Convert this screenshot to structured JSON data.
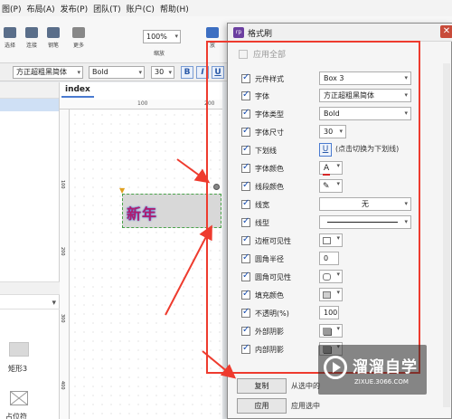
{
  "menu": [
    "图(P)",
    "布局(A)",
    "发布(P)",
    "团队(T)",
    "账户(C)",
    "帮助(H)"
  ],
  "toolbar": {
    "tools": [
      "选择",
      "连接",
      "钢笔",
      "更多"
    ],
    "zoom": "100%",
    "zoom_label": "缩放",
    "partial_label": "放"
  },
  "format_bar": {
    "font": "方正超粗黑简体",
    "weight": "Bold",
    "size": "30",
    "bold": "B",
    "italic": "I",
    "underline": "U"
  },
  "canvas": {
    "tab": "index",
    "ruler_marks": [
      "100",
      "200"
    ],
    "ruler_left_marks": [
      "100",
      "200",
      "300",
      "400"
    ],
    "widget_text": "新年"
  },
  "library": {
    "rect_label": "矩形3",
    "placeholder_label": "占位符"
  },
  "dialog": {
    "icon_text": "rp",
    "title": "格式刷",
    "apply_all": "应用全部",
    "rows": [
      {
        "label": "元件样式",
        "value": "Box 3"
      },
      {
        "label": "字体",
        "value": "方正超粗黑简体"
      },
      {
        "label": "字体类型",
        "value": "Bold"
      },
      {
        "label": "字体尺寸",
        "value": "30"
      },
      {
        "label": "下划线",
        "value": "U",
        "hint": "(点击切换为下划线)"
      },
      {
        "label": "字体颜色",
        "value": "A"
      },
      {
        "label": "线段颜色",
        "value": ""
      },
      {
        "label": "线宽",
        "value": "无"
      },
      {
        "label": "线型",
        "value": ""
      },
      {
        "label": "边框可见性",
        "value": ""
      },
      {
        "label": "圆角半径",
        "value": "0"
      },
      {
        "label": "圆角可见性",
        "value": ""
      },
      {
        "label": "填充颜色",
        "value": ""
      },
      {
        "label": "不透明(%)",
        "value": "100"
      },
      {
        "label": "外部阴影",
        "value": ""
      },
      {
        "label": "内部阴影",
        "value": ""
      }
    ],
    "copy_button": "复制",
    "copy_caption": "从选中的",
    "apply_button": "应用",
    "apply_caption": "应用选中"
  },
  "watermark": {
    "name": "溜溜自学",
    "url": "ZIXUE.3066.COM"
  },
  "colors": {
    "annotation": "#ee3b2e",
    "widget_text": "#b11a6e",
    "accent": "#4a7bd0"
  }
}
